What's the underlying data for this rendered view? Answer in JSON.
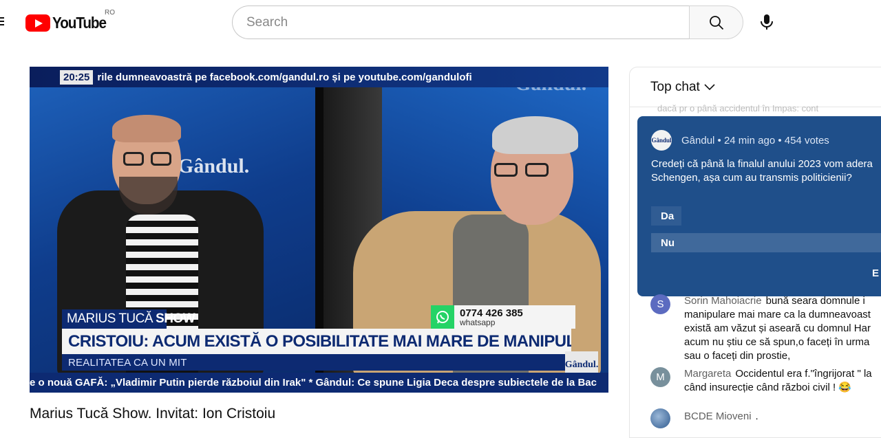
{
  "header": {
    "logo_text": "YouTube",
    "region": "RO",
    "search_placeholder": "Search"
  },
  "player": {
    "top_ticker_time": "20:25",
    "top_ticker_text": "rile  dumneavoastră pe facebook.com/gandul.ro și pe youtube.com/gandulofi",
    "watermark": "Gândul.",
    "show_name_light": "MARIUS TUCĂ",
    "show_name_bold": "SHOW",
    "headline": "CRISTOIU: ACUM EXISTĂ O POSIBILITATE MAI MARE DE MANIPULARE",
    "subheadline": "REALITATEA CA UN MIT",
    "phone_number": "0774 426 385",
    "phone_label": "whatsapp",
    "bottom_ticker": "e o nouă GAFĂ: „Vladimir Putin pierde războiul din Irak\" * Gândul: Ce spune Ligia Deca despre subiectele de la Bac",
    "corner_logo": "Gândul."
  },
  "video": {
    "title": "Marius Tucă Show. Invitat: Ion Cristoiu"
  },
  "chat": {
    "header_label": "Top chat",
    "behind_text": "dacă pr o până accidentul în Impas: cont",
    "poll": {
      "avatar_text": "Gândul",
      "meta": "Gândul • 24 min ago • 454 votes",
      "question_line1": "Credeți că până la finalul anului 2023 vom adera",
      "question_line2": "Schengen, așa cum au transmis politicienii?",
      "option_a": "Da",
      "option_b": "Nu",
      "end_label": "E"
    },
    "messages": [
      {
        "avatar_letter": "S",
        "avatar_color": "#5c6bc0",
        "author": "Sorin Mahoiacrie",
        "lines": [
          "bună seara domnule i",
          "manipulare mai mare ca la dumneavoast",
          "există am văzut și aseară cu domnul Har",
          "acum nu știu ce să spun,o faceți în urma",
          "sau o faceți din prostie,"
        ]
      },
      {
        "avatar_letter": "M",
        "avatar_color": "#78909c",
        "author": "Margareta",
        "lines": [
          "Occidentul era f.\"îngrijorat \" la",
          "când insurecție când război civil ! 😂"
        ]
      },
      {
        "avatar_letter": "",
        "avatar_color": "#3f6fa8",
        "author": "BCDE Mioveni",
        "lines": [
          "."
        ]
      }
    ]
  }
}
